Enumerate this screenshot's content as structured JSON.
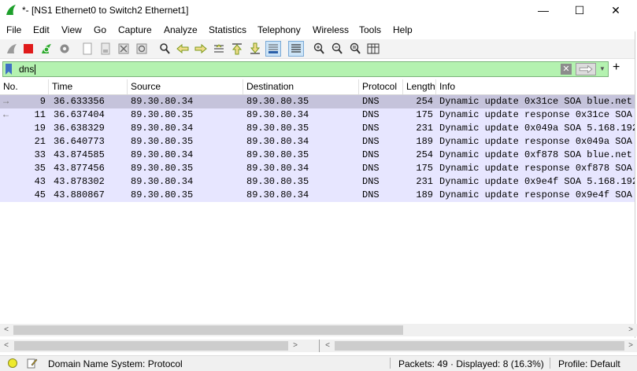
{
  "window": {
    "title": "*- [NS1 Ethernet0 to Switch2 Ethernet1]",
    "controls": {
      "minimize": "—",
      "maximize": "☐",
      "close": "✕"
    }
  },
  "menu": [
    "File",
    "Edit",
    "View",
    "Go",
    "Capture",
    "Analyze",
    "Statistics",
    "Telephony",
    "Wireless",
    "Tools",
    "Help"
  ],
  "toolbar": {
    "icons": [
      "shark-fin-start-icon",
      "stop-icon",
      "restart-icon",
      "options-gear-icon",
      "open-file-icon",
      "save-file-icon",
      "close-file-icon",
      "reload-icon",
      "find-icon",
      "go-back-icon",
      "go-forward-icon",
      "go-to-packet-icon",
      "first-packet-icon",
      "last-packet-icon",
      "auto-scroll-icon",
      "colorize-icon",
      "zoom-in-icon",
      "zoom-out-icon",
      "normal-size-icon",
      "resize-columns-icon"
    ]
  },
  "filter": {
    "value": "dns",
    "clear_icon": "✕"
  },
  "columns": [
    "No.",
    "Time",
    "Source",
    "Destination",
    "Protocol",
    "Length",
    "Info"
  ],
  "packets": [
    {
      "no": "9",
      "time": "36.633356",
      "src": "89.30.80.34",
      "dst": "89.30.80.35",
      "proto": "DNS",
      "len": "254",
      "info": "Dynamic update 0x31ce SOA blue.net",
      "marker": "→",
      "selected": true
    },
    {
      "no": "11",
      "time": "36.637404",
      "src": "89.30.80.35",
      "dst": "89.30.80.34",
      "proto": "DNS",
      "len": "175",
      "info": "Dynamic update response 0x31ce SOA",
      "marker": "←",
      "selected": false
    },
    {
      "no": "19",
      "time": "36.638329",
      "src": "89.30.80.34",
      "dst": "89.30.80.35",
      "proto": "DNS",
      "len": "231",
      "info": "Dynamic update 0x049a SOA 5.168.192",
      "marker": "",
      "selected": false
    },
    {
      "no": "21",
      "time": "36.640773",
      "src": "89.30.80.35",
      "dst": "89.30.80.34",
      "proto": "DNS",
      "len": "189",
      "info": "Dynamic update response 0x049a SOA",
      "marker": "",
      "selected": false
    },
    {
      "no": "33",
      "time": "43.874585",
      "src": "89.30.80.34",
      "dst": "89.30.80.35",
      "proto": "DNS",
      "len": "254",
      "info": "Dynamic update 0xf878 SOA blue.net",
      "marker": "",
      "selected": false
    },
    {
      "no": "35",
      "time": "43.877456",
      "src": "89.30.80.35",
      "dst": "89.30.80.34",
      "proto": "DNS",
      "len": "175",
      "info": "Dynamic update response 0xf878 SOA",
      "marker": "",
      "selected": false
    },
    {
      "no": "43",
      "time": "43.878302",
      "src": "89.30.80.34",
      "dst": "89.30.80.35",
      "proto": "DNS",
      "len": "231",
      "info": "Dynamic update 0x9e4f SOA 5.168.192",
      "marker": "",
      "selected": false
    },
    {
      "no": "45",
      "time": "43.880867",
      "src": "89.30.80.35",
      "dst": "89.30.80.34",
      "proto": "DNS",
      "len": "189",
      "info": "Dynamic update response 0x9e4f SOA",
      "marker": "",
      "selected": false
    }
  ],
  "status": {
    "field": "Domain Name System: Protocol",
    "packets": "Packets: 49 · Displayed: 8 (16.3%)",
    "profile": "Profile: Default"
  },
  "colors": {
    "row_bg": "#e7e6ff",
    "selected_row": "#c5c3db",
    "filter_valid": "#b4f2b0"
  }
}
